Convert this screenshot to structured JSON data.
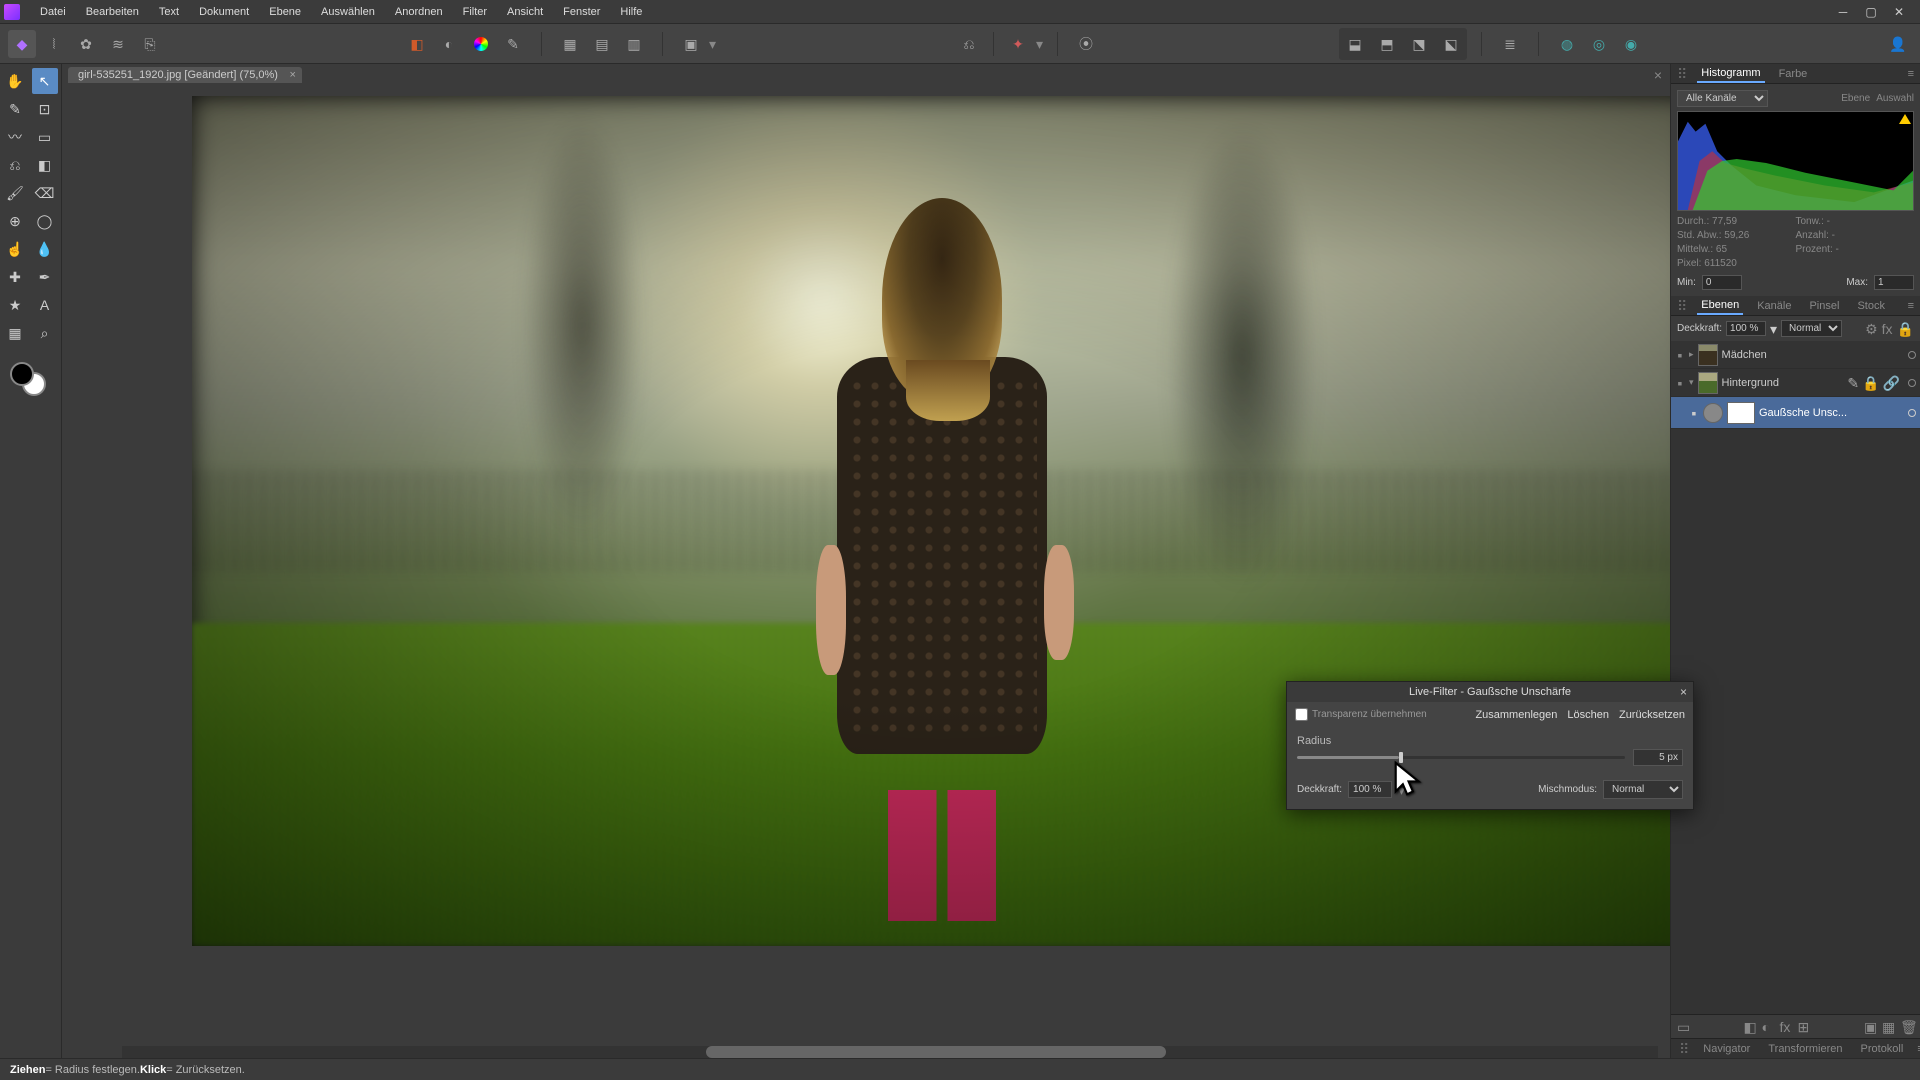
{
  "menubar": {
    "items": [
      "Datei",
      "Bearbeiten",
      "Text",
      "Dokument",
      "Ebene",
      "Auswählen",
      "Anordnen",
      "Filter",
      "Ansicht",
      "Fenster",
      "Hilfe"
    ]
  },
  "document_tab": {
    "title": "girl-535251_1920.jpg [Geändert] (75,0%)"
  },
  "dialog": {
    "title": "Live-Filter - Gaußsche Unschärfe",
    "transparency_label": "Transparenz übernehmen",
    "merge": "Zusammenlegen",
    "delete": "Löschen",
    "reset": "Zurücksetzen",
    "radius_label": "Radius",
    "radius_value": "5 px",
    "opacity_label": "Deckkraft:",
    "opacity_value": "100 %",
    "blend_label": "Mischmodus:",
    "blend_value": "Normal"
  },
  "histogram_panel": {
    "tabs": [
      "Histogramm",
      "Farbe"
    ],
    "channel_select": "Alle Kanäle",
    "right_links": [
      "Ebene",
      "Auswahl"
    ],
    "stats": {
      "mean_label": "Durch.:",
      "mean": "77,59",
      "stddev_label": "Std. Abw.:",
      "stddev": "59,26",
      "median_label": "Mittelw.:",
      "median": "65",
      "pixels_label": "Pixel:",
      "pixels": "611520",
      "tone_label": "Tonw.:",
      "tone": "-",
      "count_label": "Anzahl:",
      "count": "-",
      "percent_label": "Prozent:",
      "percent": "-"
    },
    "min_label": "Min:",
    "min": "0",
    "max_label": "Max:",
    "max": "1"
  },
  "layers_panel": {
    "tabs": [
      "Ebenen",
      "Kanäle",
      "Pinsel",
      "Stock"
    ],
    "opacity_label": "Deckkraft:",
    "opacity": "100 %",
    "blend": "Normal",
    "layers": [
      {
        "name": "Mädchen"
      },
      {
        "name": "Hintergrund"
      },
      {
        "name": "Gaußsche Unsc..."
      }
    ]
  },
  "bottom_tabs": {
    "tabs": [
      "Navigator",
      "Transformieren",
      "Protokoll"
    ]
  },
  "statusbar": {
    "bold1": "Ziehen",
    "text1": " = Radius festlegen. ",
    "bold2": "Klick",
    "text2": " = Zurücksetzen."
  },
  "toolbar_persona_icon": "A",
  "avatar_icon": "person-icon"
}
